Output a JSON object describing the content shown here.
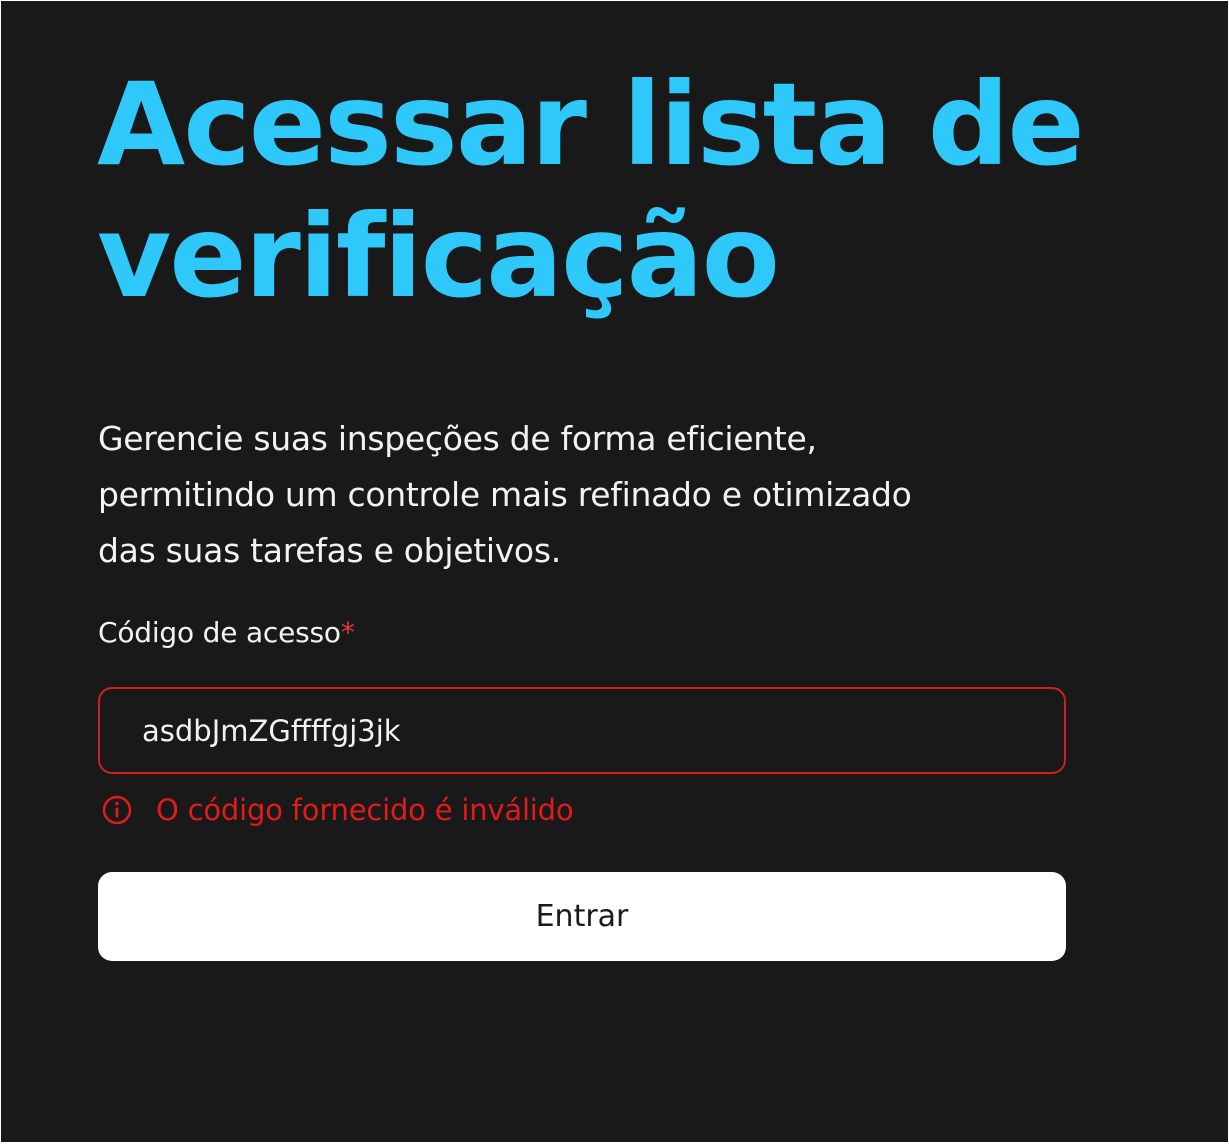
{
  "title": {
    "line1": "Acessar lista de",
    "line2": "verificação"
  },
  "description": {
    "line1": "Gerencie suas inspeções de forma eficiente,",
    "line2": "permitindo um controle mais refinado e otimizado",
    "line3": "das suas tarefas e objetivos."
  },
  "form": {
    "label": "Código de acesso",
    "required_mark": "*",
    "value": "asdbJmZGffffgj3jk",
    "error_icon": "info-icon",
    "error_message": "O código fornecido é inválido",
    "submit_label": "Entrar"
  },
  "colors": {
    "background": "#191919",
    "title": "#2fc8fa",
    "error": "#e01b1b",
    "button_background": "#ffffff"
  }
}
